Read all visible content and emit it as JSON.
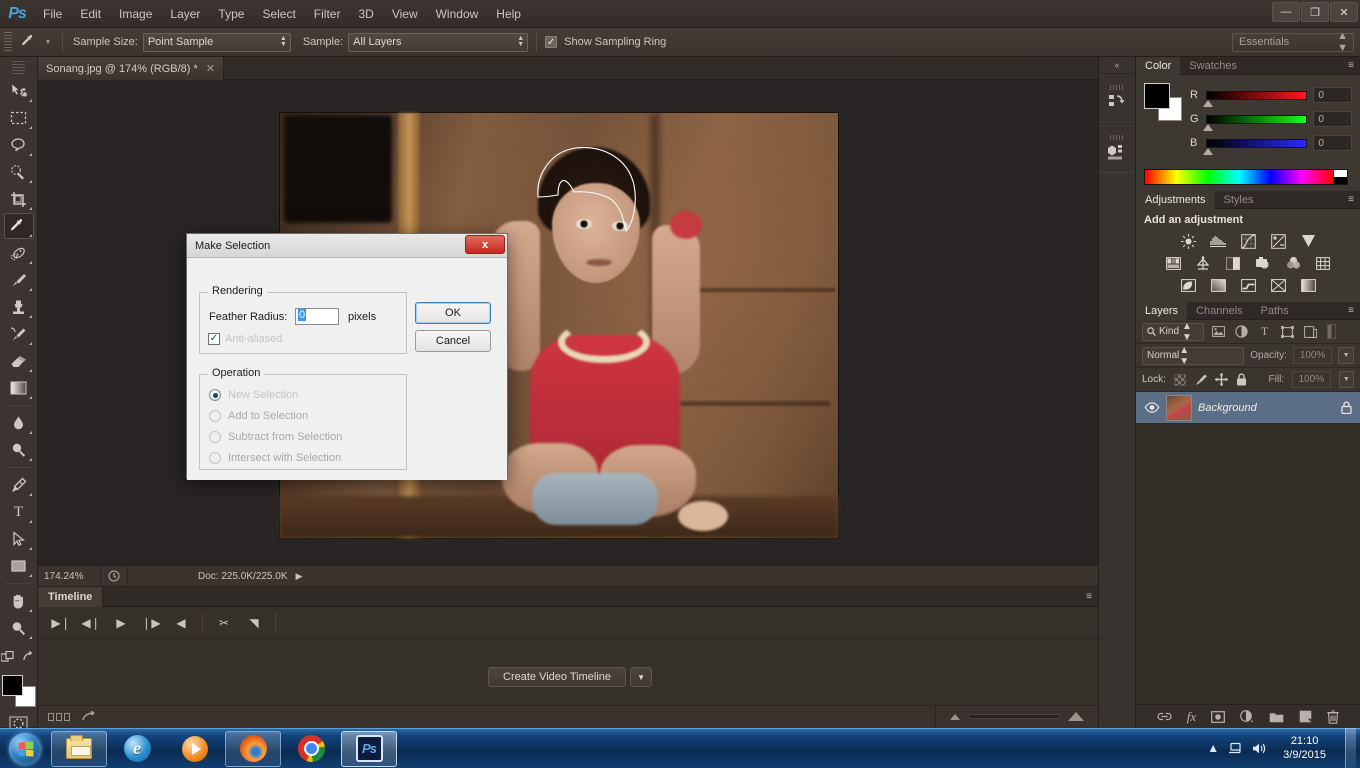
{
  "app": {
    "name": "Adobe Photoshop",
    "logo_text": "Ps",
    "workspace": "Essentials"
  },
  "menubar": {
    "items": [
      "File",
      "Edit",
      "Image",
      "Layer",
      "Type",
      "Select",
      "Filter",
      "3D",
      "View",
      "Window",
      "Help"
    ]
  },
  "window_controls": {
    "minimize": "—",
    "restore": "❐",
    "close": "✕"
  },
  "options_bar": {
    "tool_icon": "eyedropper-icon",
    "sample_size_label": "Sample Size:",
    "sample_size_value": "Point Sample",
    "sample_label": "Sample:",
    "sample_value": "All Layers",
    "show_sampling_ring_label": "Show Sampling Ring",
    "show_sampling_ring_checked": true
  },
  "toolbar": {
    "tools": [
      {
        "name": "move-tool",
        "glyph": "➤",
        "active": false
      },
      {
        "name": "rectangular-marquee-tool",
        "glyph": "⬚",
        "active": false
      },
      {
        "name": "lasso-tool",
        "glyph": "○",
        "active": false
      },
      {
        "name": "quick-selection-tool",
        "glyph": "✒",
        "active": false
      },
      {
        "name": "crop-tool",
        "glyph": "⌗",
        "active": false
      },
      {
        "name": "eyedropper-tool",
        "glyph": "✒",
        "active": true
      },
      {
        "name": "spot-healing-brush-tool",
        "glyph": "●",
        "active": false
      },
      {
        "name": "brush-tool",
        "glyph": "╱",
        "active": false
      },
      {
        "name": "clone-stamp-tool",
        "glyph": "⚑",
        "active": false
      },
      {
        "name": "history-brush-tool",
        "glyph": "✐",
        "active": false
      },
      {
        "name": "eraser-tool",
        "glyph": "▱",
        "active": false
      },
      {
        "name": "gradient-tool",
        "glyph": "▤",
        "active": false
      },
      {
        "name": "blur-tool",
        "glyph": "●",
        "active": false
      },
      {
        "name": "dodge-tool",
        "glyph": "⚲",
        "active": false
      },
      {
        "name": "pen-tool",
        "glyph": "✒",
        "active": false
      },
      {
        "name": "type-tool",
        "glyph": "T",
        "active": false
      },
      {
        "name": "path-selection-tool",
        "glyph": "➤",
        "active": false
      },
      {
        "name": "rectangle-tool",
        "glyph": "■",
        "active": false
      },
      {
        "name": "hand-tool",
        "glyph": "✋",
        "active": false
      },
      {
        "name": "zoom-tool",
        "glyph": "⚲",
        "active": false
      }
    ],
    "foreground_color": "#000000",
    "background_color": "#ffffff"
  },
  "document": {
    "tab_title": "Sonang.jpg @ 174% (RGB/8) *",
    "close_glyph": "✕"
  },
  "status_bar": {
    "zoom": "174.24%",
    "doc_info": "Doc: 225.0K/225.0K",
    "expand_glyph": "▶"
  },
  "timeline": {
    "tab_label": "Timeline",
    "menu_glyph": "≡",
    "controls": [
      {
        "name": "go-to-first-frame-button",
        "glyph": "▶❘"
      },
      {
        "name": "previous-frame-button",
        "glyph": "◀❘"
      },
      {
        "name": "play-button",
        "glyph": "▶"
      },
      {
        "name": "next-frame-button",
        "glyph": "❘▶"
      },
      {
        "name": "audio-button",
        "glyph": "◀"
      },
      {
        "name": "split-clip-button",
        "glyph": "✂"
      },
      {
        "name": "transition-button",
        "glyph": "◥"
      }
    ],
    "create_video_timeline_label": "Create Video Timeline",
    "dropdown_glyph": "▼",
    "convert_frames_glyph": "➦"
  },
  "color_panel": {
    "tabs": [
      "Color",
      "Swatches"
    ],
    "active_tab": "Color",
    "menu_glyph": "≡",
    "channels": [
      {
        "label": "R",
        "value": "0"
      },
      {
        "label": "G",
        "value": "0"
      },
      {
        "label": "B",
        "value": "0"
      }
    ]
  },
  "adjustments_panel": {
    "tabs": [
      "Adjustments",
      "Styles"
    ],
    "active_tab": "Adjustments",
    "menu_glyph": "≡",
    "title": "Add an adjustment",
    "icons": [
      [
        "brightness-contrast-icon",
        "levels-icon",
        "curves-icon",
        "exposure-icon",
        "vibrance-icon"
      ],
      [
        "hue-saturation-icon",
        "color-balance-icon",
        "black-white-icon",
        "photo-filter-icon",
        "channel-mixer-icon",
        "color-lookup-icon"
      ],
      [
        "invert-icon",
        "posterize-icon",
        "threshold-icon",
        "selective-color-icon",
        "gradient-map-icon"
      ]
    ]
  },
  "layers_panel": {
    "tabs": [
      "Layers",
      "Channels",
      "Paths"
    ],
    "active_tab": "Layers",
    "menu_glyph": "≡",
    "filter_kind_label": "Kind",
    "filter_icons": [
      "pixel-layer-filter-icon",
      "adjustment-layer-filter-icon",
      "type-layer-filter-icon",
      "shape-layer-filter-icon",
      "smart-object-filter-icon"
    ],
    "blend_mode": "Normal",
    "opacity_label": "Opacity:",
    "opacity_value": "100%",
    "lock_label": "Lock:",
    "lock_icons": [
      "lock-transparent-pixels-icon",
      "lock-image-pixels-icon",
      "lock-position-icon",
      "lock-all-icon"
    ],
    "fill_label": "Fill:",
    "fill_value": "100%",
    "layers": [
      {
        "name": "Background",
        "visible": true,
        "locked": true,
        "selected": true
      }
    ],
    "bottom_icons": [
      "link-layers-icon",
      "layer-style-icon",
      "layer-mask-icon",
      "new-adjustment-layer-icon",
      "new-group-icon",
      "new-layer-icon",
      "delete-layer-icon"
    ]
  },
  "mini_dock": {
    "collapse_glyph": "«",
    "items": [
      "history-panel-icon",
      "3d-panel-icon"
    ]
  },
  "dialog": {
    "title": "Make Selection",
    "close_label": "x",
    "rendering_legend": "Rendering",
    "feather_radius_label": "Feather Radius:",
    "feather_radius_value": "0",
    "pixels_label": "pixels",
    "anti_aliased_label": "Anti-aliased",
    "anti_aliased_checked": true,
    "anti_aliased_check_glyph": "✓",
    "operation_legend": "Operation",
    "operations": [
      {
        "label": "New Selection",
        "selected": true,
        "enabled": true
      },
      {
        "label": "Add to Selection",
        "selected": false,
        "enabled": false
      },
      {
        "label": "Subtract from Selection",
        "selected": false,
        "enabled": false
      },
      {
        "label": "Intersect with Selection",
        "selected": false,
        "enabled": false
      }
    ],
    "ok_label": "OK",
    "cancel_label": "Cancel"
  },
  "taskbar": {
    "start_label": "Start",
    "apps": [
      {
        "name": "windows-explorer-taskbar-item",
        "running": true,
        "active": false
      },
      {
        "name": "internet-explorer-taskbar-item",
        "running": false,
        "active": false
      },
      {
        "name": "windows-media-player-taskbar-item",
        "running": false,
        "active": false
      },
      {
        "name": "firefox-taskbar-item",
        "running": true,
        "active": false
      },
      {
        "name": "chrome-taskbar-item",
        "running": false,
        "active": false
      },
      {
        "name": "photoshop-taskbar-item",
        "running": true,
        "active": true
      }
    ],
    "tray": {
      "show_hidden_glyph": "▲",
      "network_icon": "network-icon",
      "volume_icon": "volume-icon",
      "time": "21:10",
      "date": "3/9/2015"
    }
  }
}
